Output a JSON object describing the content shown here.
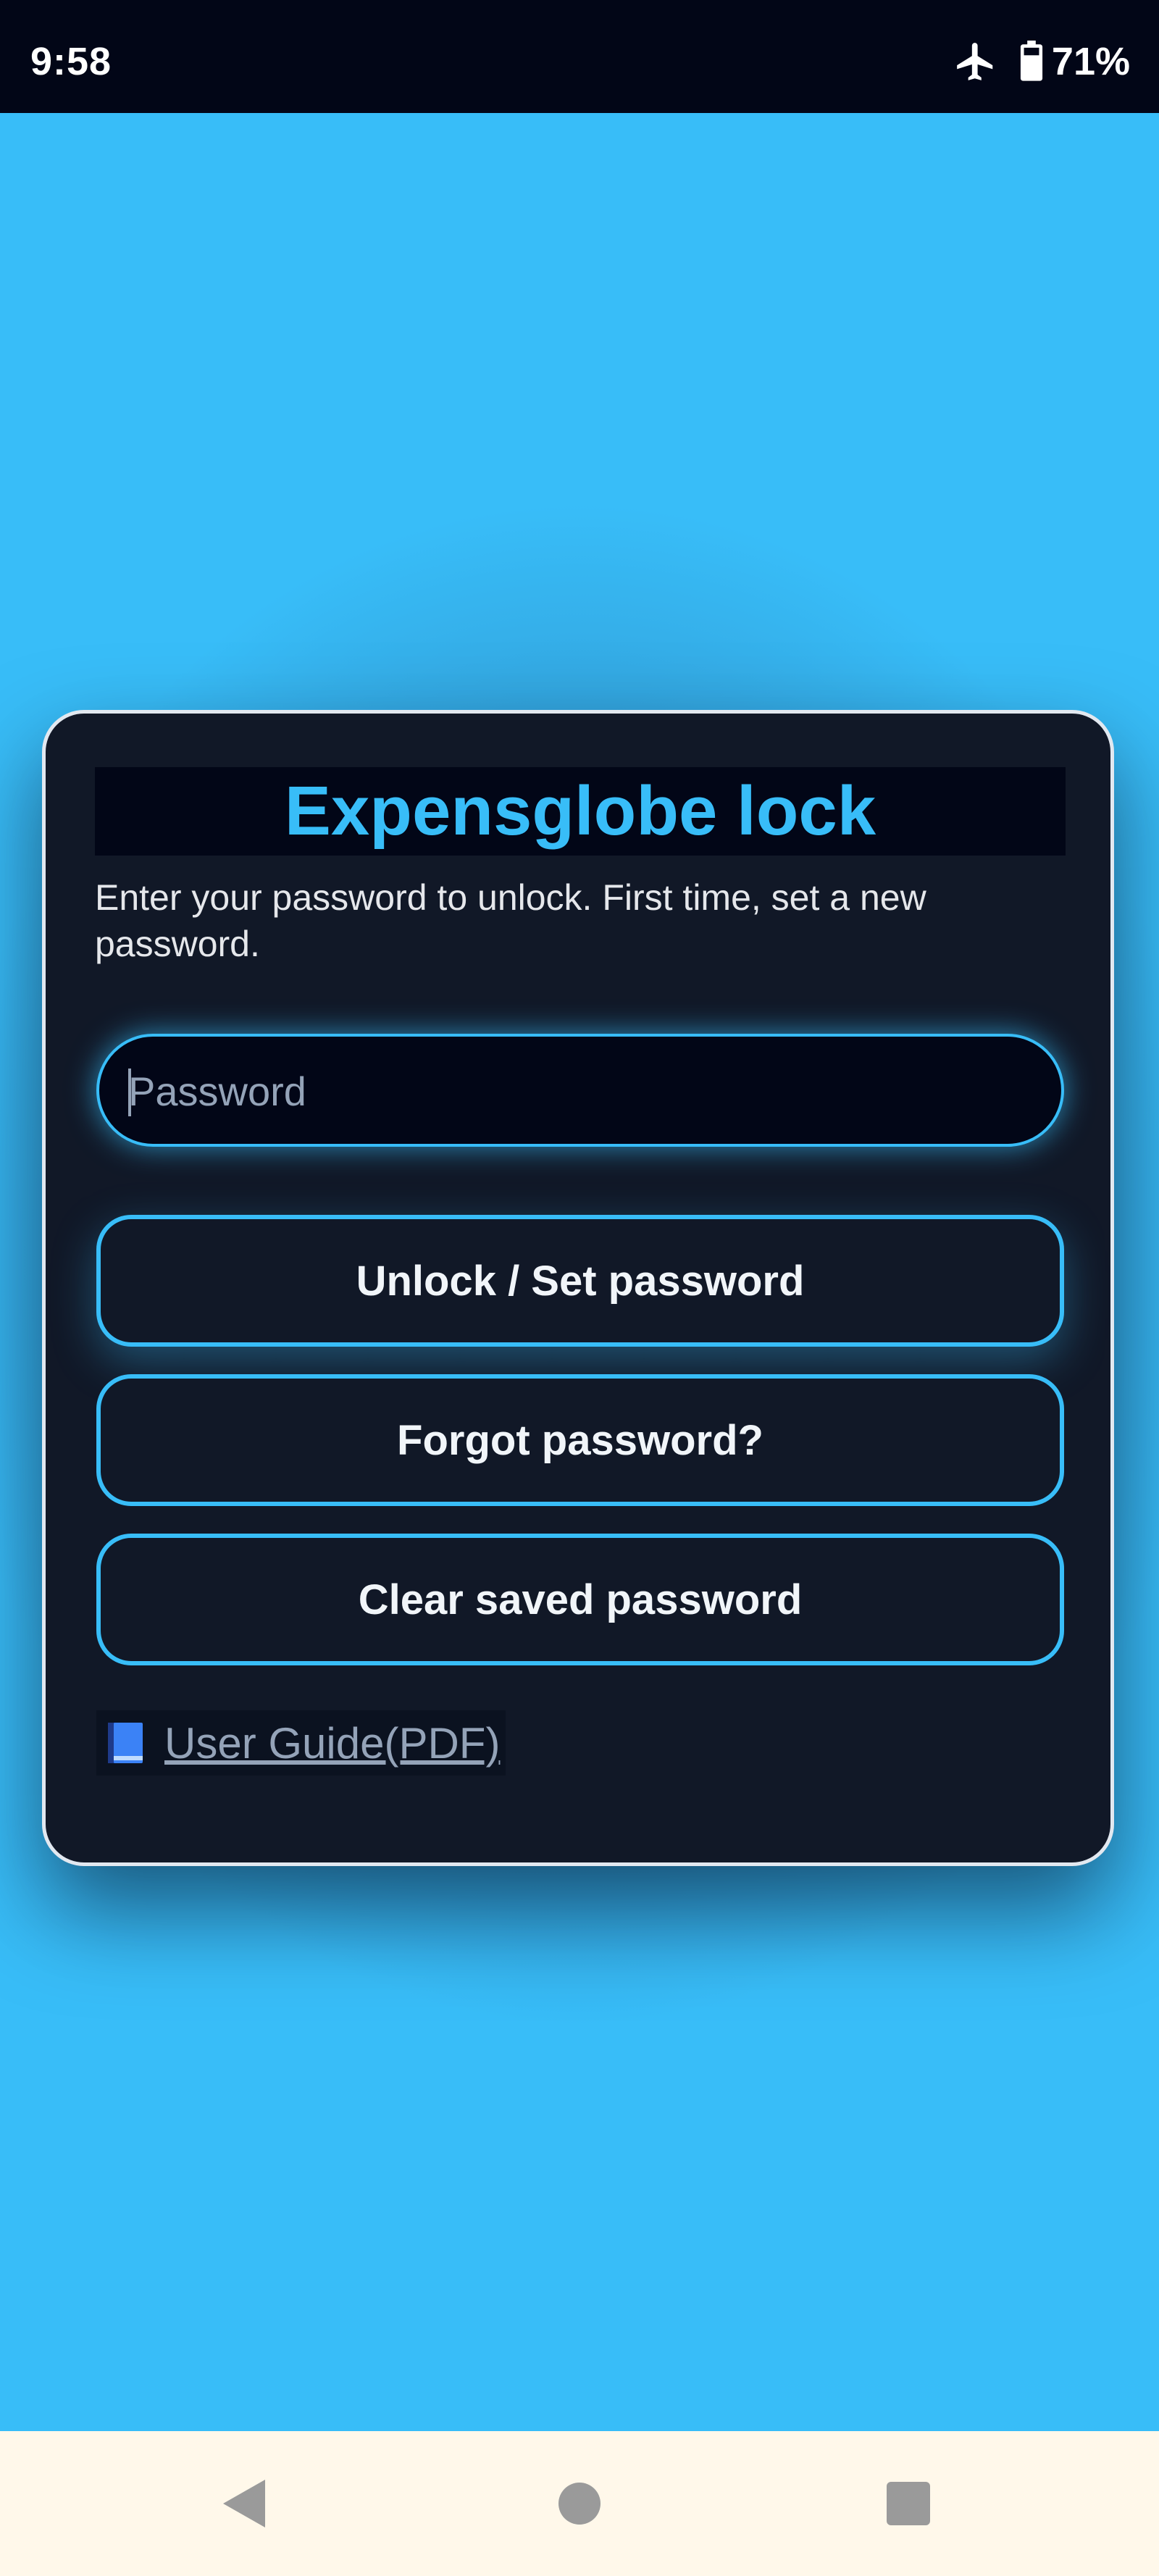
{
  "status_bar": {
    "time": "9:58",
    "battery_percent": "71%",
    "icons": [
      "airplane-icon",
      "battery-icon"
    ]
  },
  "card": {
    "title": "Expensglobe lock",
    "subtitle": "Enter your password to unlock. First time, set a new password.",
    "password": {
      "placeholder": "Password",
      "value": ""
    },
    "buttons": {
      "unlock": "Unlock / Set password",
      "forgot": "Forgot password?",
      "clear": "Clear saved password"
    },
    "guide_link": {
      "icon": "book-icon",
      "label": "User Guide(PDF)"
    }
  },
  "nav_bar": {
    "icons": [
      "back-icon",
      "home-icon",
      "recents-icon"
    ]
  },
  "colors": {
    "accent": "#38bdf8",
    "card_bg": "#111827",
    "status_bar_bg": "#020617",
    "nav_bar_bg": "#fff8ea"
  }
}
